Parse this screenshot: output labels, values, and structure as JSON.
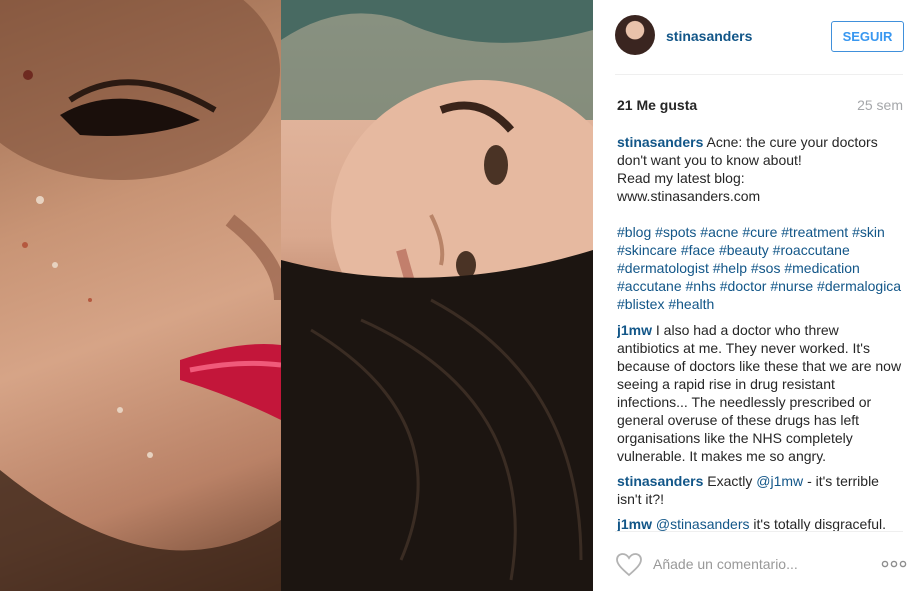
{
  "post": {
    "username": "stinasanders",
    "follow_label": "SEGUIR",
    "likes": "21 Me gusta",
    "time": "25 sem",
    "caption": {
      "user": "stinasanders",
      "text_line1": "Acne: the cure your doctors don't want you to know about!",
      "text_line2": "Read my latest blog:",
      "text_line3": "www.stinasanders.com"
    },
    "hashtags": [
      "#blog",
      "#spots",
      "#acne",
      "#cure",
      "#treatment",
      "#skin",
      "#skincare",
      "#face",
      "#beauty",
      "#roaccutane",
      "#dermatologist",
      "#help",
      "#sos",
      "#medication",
      "#accutane",
      "#nhs",
      "#doctor",
      "#nurse",
      "#dermalogica",
      "#blistex",
      "#health"
    ],
    "comments": [
      {
        "user": "j1mw",
        "mention": "",
        "text": "I also had a doctor who threw antibiotics at me. They never worked. It's because of doctors like these that we are now seeing a rapid rise in drug resistant infections... The needlessly prescribed or general overuse of these drugs has left organisations like the NHS completely vulnerable. It makes me so angry."
      },
      {
        "user": "stinasanders",
        "text_before": "Exactly",
        "mention": "@j1mw",
        "text": "- it's terrible isn't it?!"
      },
      {
        "user": "j1mw",
        "mention": "@stinasanders",
        "text": "it's totally disgraceful."
      }
    ],
    "comment_placeholder": "Añade un comentario..."
  },
  "icons": {
    "avatar": "avatar",
    "like": "heart-icon",
    "more": "more-options-icon"
  },
  "colors": {
    "link": "#125688",
    "follow_border": "#4090db",
    "follow_text": "#3897f0",
    "muted": "#a5a7aa"
  }
}
